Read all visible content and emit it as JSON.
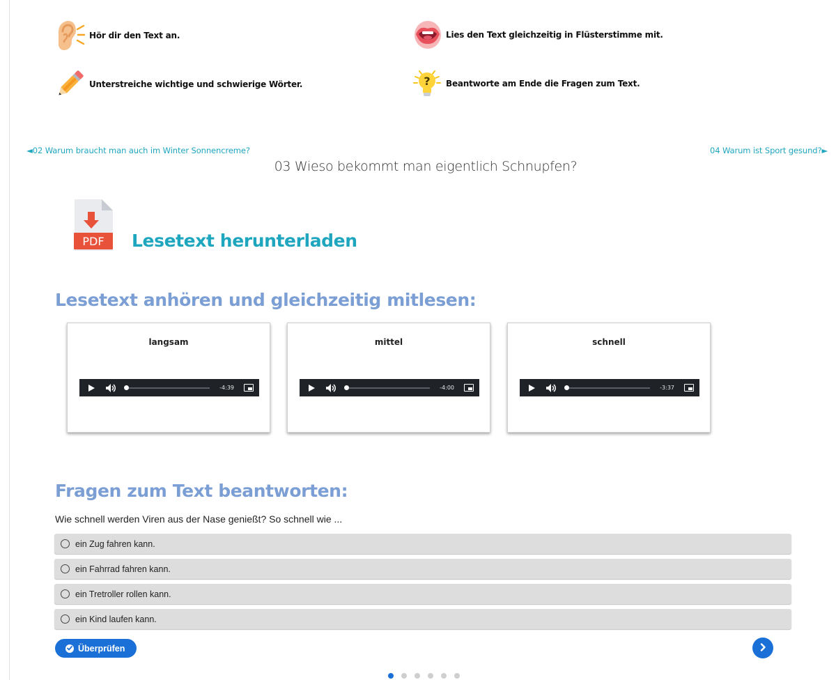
{
  "tips": [
    {
      "label": "Hör dir den Text an.",
      "icon": "ear-icon"
    },
    {
      "label": "Lies den Text gleichzeitig in Flüsterstimme mit.",
      "icon": "mouth-icon"
    },
    {
      "label": "Unterstreiche wichtige und schwierige Wörter.",
      "icon": "pencil-icon"
    },
    {
      "label": "Beantworte am Ende die Fragen zum Text.",
      "icon": "lightbulb-question-icon"
    }
  ],
  "nav": {
    "prev_label": "◄02 Warum braucht man auch im Winter Sonnencreme?",
    "next_label": "04 Warum ist Sport gesund?►",
    "title": "03 Wieso bekommt man eigentlich Schnupfen?"
  },
  "download": {
    "icon_text": "PDF",
    "label": "Lesetext herunterladen"
  },
  "listen_heading": "Lesetext anhören und gleichzeitig mitlesen:",
  "audio_players": [
    {
      "label": "langsam",
      "time": "-4:39"
    },
    {
      "label": "mittel",
      "time": "-4:00"
    },
    {
      "label": "schnell",
      "time": "-3:37"
    }
  ],
  "quiz": {
    "heading": "Fragen zum Text beantworten:",
    "question": "Wie schnell werden Viren aus der Nase genießt? So schnell wie ...",
    "options": [
      "ein Zug fahren kann.",
      "ein Fahrrad fahren kann.",
      "ein Tretroller rollen kann.",
      "ein Kind laufen kann."
    ],
    "check_label": "Überprüfen",
    "total_pages": 6,
    "current_page": 1
  },
  "colors": {
    "link_teal": "#1fa6bf",
    "heading_blue": "#7b9fd4",
    "button_blue": "#1a70d6",
    "option_bg": "#dddddd",
    "player_bg": "#1f2227"
  }
}
